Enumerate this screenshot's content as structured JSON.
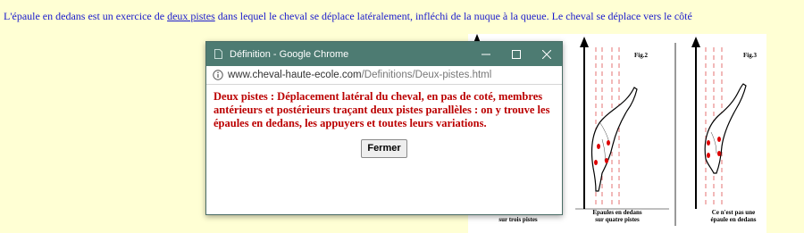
{
  "intro": {
    "before": "L'épaule en dedans est un exercice de ",
    "link": "deux pistes",
    "after": " dans lequel le cheval se déplace latéralement, infléchi de la nuque à la queue. Le cheval se déplace vers le côté"
  },
  "popup": {
    "window_title": "Définition - Google Chrome",
    "url_domain": "www.cheval-haute-ecole.com",
    "url_path": "/Definitions/Deux-pistes.html",
    "definition": "Deux pistes : Déplacement latéral du cheval, en pas de coté, membres antérieurs et postérieurs traçant deux pistes parallèles : on y trouve les épaules en dedans, les appuyers et toutes leurs variations.",
    "close_button": "Fermer",
    "controls": {
      "minimize": "–",
      "maximize": "☐",
      "close": "✕"
    }
  },
  "figure": {
    "fig2_title": "Fig.2",
    "fig3_title": "Fig.3",
    "caption1": "sur trois pistes",
    "caption2_line1": "Epaules en dedans",
    "caption2_line2": "sur quatre pistes",
    "caption3_line1": "Ce n'est pas une",
    "caption3_line2": "épaule en dedans"
  },
  "colors": {
    "background": "#ffffd4",
    "titlebar": "#4d7b72",
    "link": "#1a1acc",
    "definition_text": "#bb0000",
    "hoof_marks": "#dd0000"
  }
}
